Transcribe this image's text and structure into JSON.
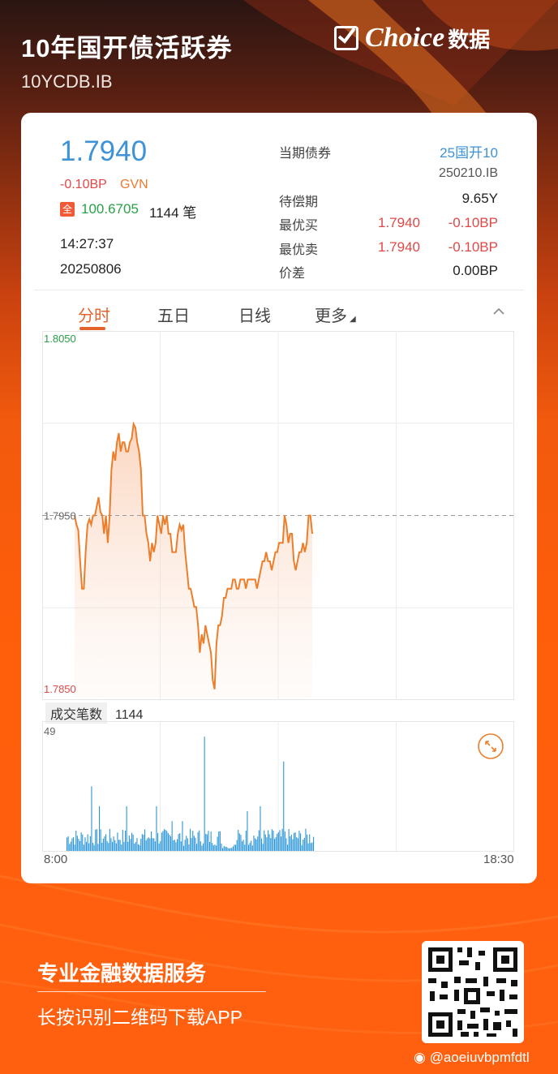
{
  "header": {
    "title": "10年国开债活跃券",
    "code": "10YCDB.IB"
  },
  "brand": {
    "name": "Choice",
    "suffix": "数据"
  },
  "quote": {
    "price": "1.7940",
    "change": "-0.10BP",
    "source": "GVN",
    "full_badge": "全",
    "full_price": "100.6705",
    "trade_count": "1144 笔",
    "time": "14:27:37",
    "date": "20250806"
  },
  "details": {
    "current_bond_label": "当期债券",
    "current_bond_name": "25国开10",
    "current_bond_code": "250210.IB",
    "maturity_label": "待偿期",
    "maturity_value": "9.65Y",
    "best_bid_label": "最优买",
    "best_bid_price": "1.7940",
    "best_bid_change": "-0.10BP",
    "best_ask_label": "最优卖",
    "best_ask_price": "1.7940",
    "best_ask_change": "-0.10BP",
    "spread_label": "价差",
    "spread_value": "0.00BP"
  },
  "tabs": [
    {
      "label": "分时",
      "active": true
    },
    {
      "label": "五日"
    },
    {
      "label": "日线"
    },
    {
      "label": "更多"
    }
  ],
  "volume": {
    "label": "成交笔数",
    "count": "1144",
    "max_label": "49"
  },
  "colors": {
    "accent": "#e4632a",
    "up": "#2aa048",
    "down": "#e04848",
    "price": "#3d93d6",
    "volume": "#2b96d8"
  },
  "chart_data": {
    "type": "line",
    "ylim": [
      1.785,
      1.805
    ],
    "y_ticks": [
      "1.8050",
      "1.7950",
      "1.7850"
    ],
    "x_ticks": [
      "8:00",
      "18:30"
    ],
    "reference_line": 1.795,
    "series": [
      {
        "values": [
          1.795,
          1.7945,
          1.7942,
          1.7925,
          1.791,
          1.791,
          1.793,
          1.7945,
          1.7948,
          1.7945,
          1.795,
          1.795,
          1.7955,
          1.796,
          1.7952,
          1.795,
          1.794,
          1.795,
          1.7935,
          1.795,
          1.7975,
          1.7985,
          1.798,
          1.799,
          1.7995,
          1.7985,
          1.799,
          1.799,
          1.7985,
          1.7985,
          1.799,
          1.7992,
          1.8,
          1.7998,
          1.799,
          1.7985,
          1.7975,
          1.795,
          1.795,
          1.794,
          1.7935,
          1.7925,
          1.7935,
          1.793,
          1.7935,
          1.795,
          1.7945,
          1.794,
          1.795,
          1.7945,
          1.795,
          1.794,
          1.794,
          1.793,
          1.793,
          1.793,
          1.794,
          1.7945,
          1.7942,
          1.7945,
          1.793,
          1.792,
          1.791,
          1.791,
          1.7905,
          1.79,
          1.79,
          1.789,
          1.7875,
          1.7885,
          1.788,
          1.789,
          1.7885,
          1.788,
          1.7875,
          1.786,
          1.7855,
          1.788,
          1.789,
          1.789,
          1.7895,
          1.7905,
          1.7905,
          1.791,
          1.791,
          1.791,
          1.7915,
          1.7915,
          1.791,
          1.791,
          1.7915,
          1.7915,
          1.7915,
          1.791,
          1.7915,
          1.7915,
          1.7915,
          1.7915,
          1.7915,
          1.791,
          1.7915,
          1.792,
          1.7925,
          1.7925,
          1.793,
          1.7925,
          1.7925,
          1.792,
          1.7925,
          1.793,
          1.793,
          1.7935,
          1.7935,
          1.7935,
          1.795,
          1.7945,
          1.7935,
          1.794,
          1.794,
          1.7925,
          1.792,
          1.7925,
          1.793,
          1.793,
          1.7935,
          1.793,
          1.7935,
          1.795,
          1.795,
          1.794
        ]
      }
    ]
  }
}
